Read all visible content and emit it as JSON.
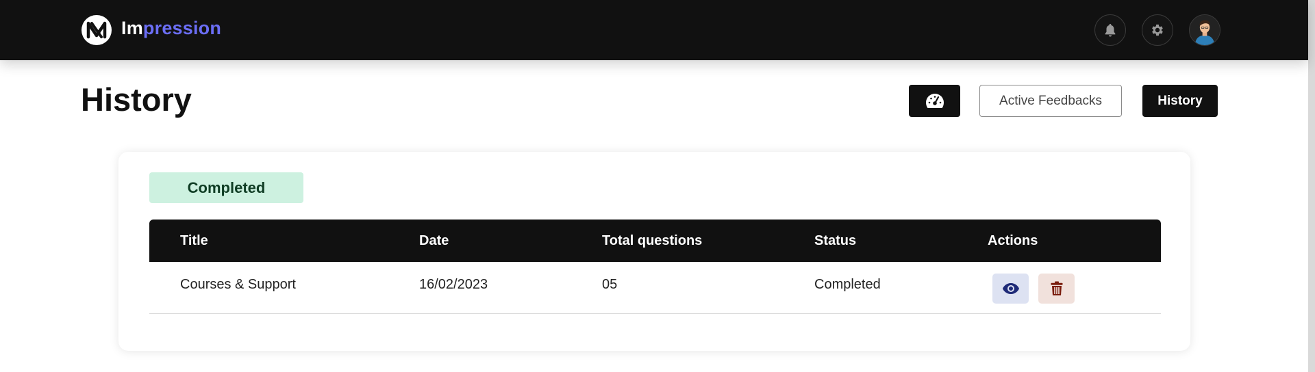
{
  "app": {
    "brand_part1": "Im",
    "brand_part2": "pression",
    "icons": [
      "logo-icon",
      "bell-icon",
      "gear-icon",
      "avatar"
    ]
  },
  "page": {
    "title": "History"
  },
  "header_actions": {
    "dashboard_icon": "speedometer-icon",
    "active_feedbacks_label": "Active Feedbacks",
    "history_label": "History"
  },
  "card": {
    "status_filter": "Completed",
    "columns": [
      "Title",
      "Date",
      "Total questions",
      "Status",
      "Actions"
    ],
    "rows": [
      {
        "title": "Courses & Support",
        "date": "16/02/2023",
        "total_questions": "05",
        "status": "Completed",
        "actions": [
          "eye-icon",
          "trash-icon"
        ]
      }
    ]
  },
  "colors": {
    "topbar": "#111111",
    "brand_accent": "#6b6ef5",
    "completed_pill_bg": "#cdf1e0",
    "completed_pill_text": "#0f3d24",
    "view_btn_bg": "#dde2f2",
    "view_icon": "#1e2a78",
    "delete_btn_bg": "#f1e1dc",
    "delete_icon": "#7a1d0e"
  }
}
